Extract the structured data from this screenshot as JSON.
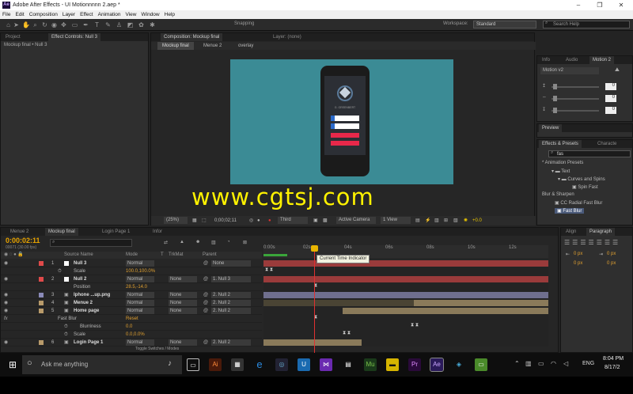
{
  "window": {
    "title": "Adobe After Effects - UI Motionnnnn 2.aep *",
    "app_badge": "Ae"
  },
  "menu": [
    "File",
    "Edit",
    "Composition",
    "Layer",
    "Effect",
    "Animation",
    "View",
    "Window",
    "Help"
  ],
  "toolbar": {
    "snapping": "Snapping",
    "workspace_label": "Workspace:",
    "workspace_value": "Standard",
    "search_placeholder": "Search Help"
  },
  "project": {
    "tabs": [
      "Project",
      "Effect Controls: Null 3"
    ],
    "breadcrumb": "Mockup final • Null 3"
  },
  "composition": {
    "tabs": [
      "Composition: Mockup final",
      "Layer: (none)"
    ],
    "subtabs": [
      "Mockup final",
      "Menue 2",
      "overlay"
    ],
    "zoom": "(25%)",
    "timecode": "0;00;02;11",
    "resolution": "Third",
    "camera": "Active Camera",
    "view": "1 View",
    "exposure": "+0.0"
  },
  "phone": {
    "name": "G. GREENBERT",
    "button_color": "#e8284a"
  },
  "watermark": "www.cgtsj.com",
  "info": {
    "tabs": [
      "Info",
      "Audio",
      "Motion 2"
    ],
    "dropdown": "Motion v2",
    "values": [
      "0",
      "0",
      "0",
      "0"
    ]
  },
  "preview": {
    "tab": "Preview"
  },
  "effects": {
    "tabs": [
      "Effects & Presets",
      "Characte"
    ],
    "search_value": "fas",
    "tree": [
      "* Animation Presets",
      "Text",
      "Curves and Spins",
      "Spin Fast",
      "Blur & Sharpen",
      "CC Radial Fast Blur",
      "Fast Blur"
    ]
  },
  "timeline": {
    "tabs": [
      "Menue 2",
      "Mockup final",
      "Login Page 1",
      "Infor"
    ],
    "timecode": "0:00:02:11",
    "fps": "00071 (30.00 fps)",
    "headers": {
      "source": "Source Name",
      "mode": "Mode",
      "t": "T",
      "trkmat": "TrkMat",
      "parent": "Parent"
    },
    "ruler": [
      "0:00s",
      "02s",
      "04s",
      "06s",
      "08s",
      "10s",
      "12s"
    ],
    "tooltip": "Current Time Indicator",
    "footer": "Toggle Switches / Modes",
    "rows": [
      {
        "num": "1",
        "name": "Null 3",
        "mode": "Normal",
        "trk": "",
        "parent": "None",
        "color": "#e04a4a"
      },
      {
        "sub": "Scale",
        "value": "100.0,100.0%"
      },
      {
        "num": "2",
        "name": "Null 2",
        "mode": "Normal",
        "trk": "None",
        "parent": "1. Null 3",
        "color": "#e04a4a"
      },
      {
        "sub": "Position",
        "value": "28.5,-14.0"
      },
      {
        "num": "3",
        "name": "Iphone ...up.png",
        "mode": "Normal",
        "trk": "None",
        "parent": "2. Null 2",
        "color": "#8a8ab8"
      },
      {
        "num": "4",
        "name": "Menue 2",
        "mode": "Normal",
        "trk": "None",
        "parent": "2. Null 2",
        "color": "#b89a6a"
      },
      {
        "num": "5",
        "name": "Home page",
        "mode": "Normal",
        "trk": "None",
        "parent": "2. Null 2",
        "color": "#b89a6a"
      },
      {
        "sub": "Fast Blur",
        "value": "Reset"
      },
      {
        "sub": "Blurriness",
        "value": "0.0"
      },
      {
        "sub": "Scale",
        "value": "0.0,0.0%"
      },
      {
        "num": "6",
        "name": "Login Page 1",
        "mode": "Normal",
        "trk": "None",
        "parent": "2. Null 2",
        "color": "#b89a6a"
      }
    ]
  },
  "align": {
    "tabs": [
      "Align",
      "Paragraph"
    ],
    "px": [
      "0 px",
      "0 px",
      "0 px",
      "0 px"
    ]
  },
  "taskbar": {
    "search": "Ask me anything",
    "time": "8:04 PM",
    "date": "8/17/2",
    "lang": "ENG"
  }
}
